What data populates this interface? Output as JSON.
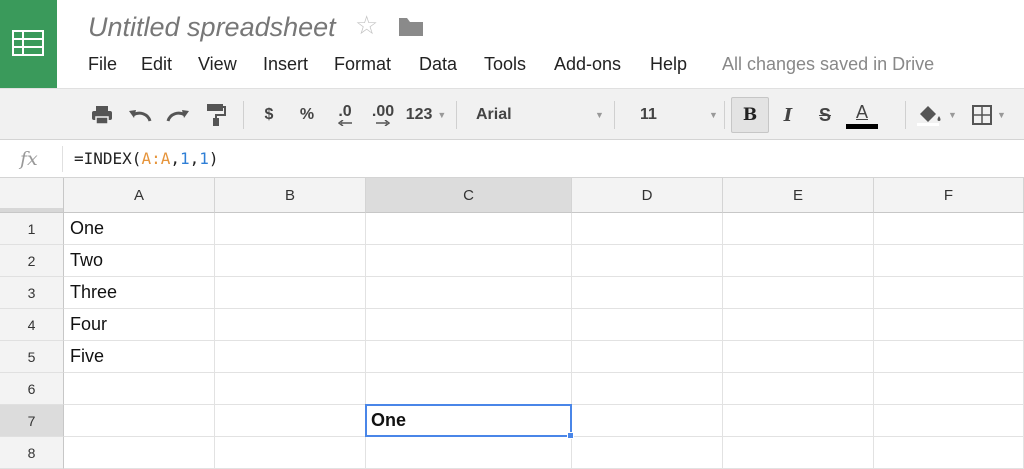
{
  "app": {
    "doc_title": "Untitled spreadsheet",
    "save_status": "All changes saved in Drive",
    "accent_color": "#3a9a5b"
  },
  "menu": [
    "File",
    "Edit",
    "View",
    "Insert",
    "Format",
    "Data",
    "Tools",
    "Add-ons",
    "Help"
  ],
  "toolbar": {
    "currency_label": "$",
    "percent_label": "%",
    "decrease_decimal_label": ".0",
    "increase_decimal_label": ".00",
    "number_format_label": "123",
    "font_family_value": "Arial",
    "font_size_value": "11",
    "bold_label": "B",
    "italic_label": "I",
    "strike_label": "S",
    "text_color_label": "A",
    "icons": [
      "print-icon",
      "undo-icon",
      "redo-icon",
      "paint-format-icon",
      "fill-color-icon",
      "borders-icon"
    ]
  },
  "formula_bar": {
    "fx_label": "fx",
    "formula_prefix": "=INDEX(",
    "formula_range": "A:A",
    "formula_sep1": ",",
    "formula_arg1": "1",
    "formula_sep2": ",",
    "formula_arg2": "1",
    "formula_suffix": ")"
  },
  "grid": {
    "columns": [
      "A",
      "B",
      "C",
      "D",
      "E",
      "F"
    ],
    "rows": [
      "1",
      "2",
      "3",
      "4",
      "5",
      "6",
      "7",
      "8"
    ],
    "cells": {
      "A1": "One",
      "A2": "Two",
      "A3": "Three",
      "A4": "Four",
      "A5": "Five",
      "C7": "One"
    },
    "selected_cell": "C7",
    "selection_color": "#4a86e8"
  }
}
